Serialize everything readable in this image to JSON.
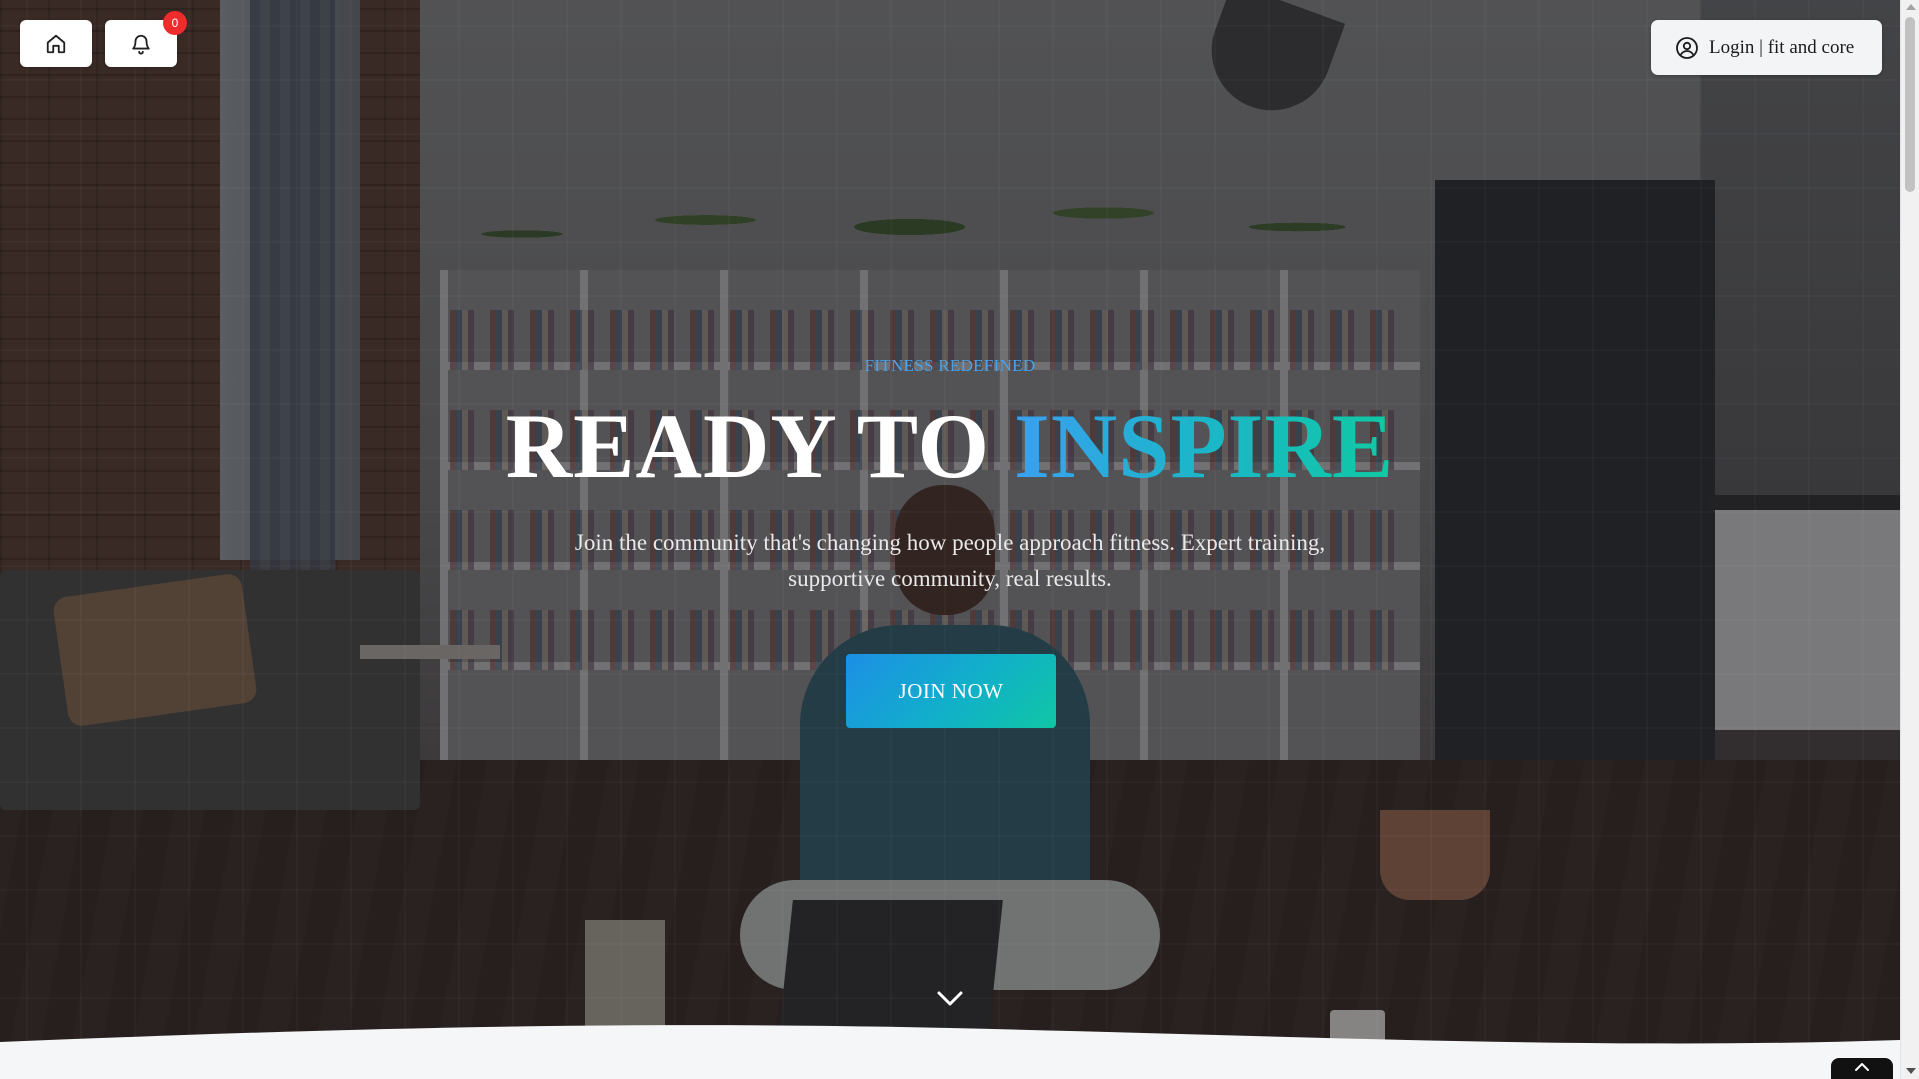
{
  "header": {
    "home_icon": "home-icon",
    "bell_icon": "bell-icon",
    "notification_count": "0",
    "login_label": "Login | fit and core",
    "login_icon": "user-circle-icon"
  },
  "hero": {
    "kicker": "FITNESS REDEFINED",
    "headline_plain": "READY TO",
    "headline_accent": "INSPIRE",
    "subhead": "Join the community that's changing how people approach fitness. Expert training, supportive community, real results.",
    "cta_label": "JOIN NOW",
    "scroll_icon": "chevron-down-icon"
  },
  "footer": {
    "back_to_top_icon": "chevron-up-icon"
  },
  "colors": {
    "accent_start": "#3aa0f0",
    "accent_end": "#10c9a3",
    "badge": "#ef2b2b",
    "kicker": "#4aa3e8"
  }
}
